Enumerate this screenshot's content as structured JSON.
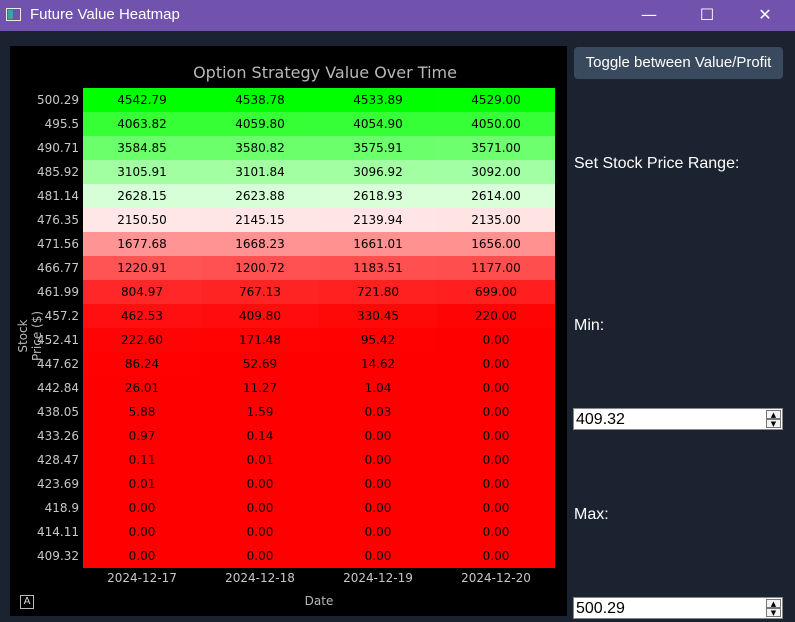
{
  "window": {
    "title": "Future Value Heatmap",
    "minimize_glyph": "—",
    "maximize_glyph": "☐",
    "close_glyph": "✕"
  },
  "plot": {
    "title": "Option Strategy Value Over Time",
    "xlabel": "Date",
    "ylabel": "Stock Price ($)",
    "auto_range_label": "A"
  },
  "controls": {
    "toggle_label": "Toggle between Value/Profit",
    "range_label": "Set Stock Price Range:",
    "min_label": "Min:",
    "min_value": "409.32",
    "max_label": "Max:",
    "max_value": "500.29"
  },
  "colors": {
    "titlebar": "#7152ad",
    "panel_bg": "#1b2330",
    "plot_bg": "#000000",
    "button_bg": "#3a4a5e",
    "high": "#00ff00",
    "low": "#ff0000"
  },
  "chart_data": {
    "type": "heatmap",
    "title": "Option Strategy Value Over Time",
    "xlabel": "Date",
    "ylabel": "Stock Price ($)",
    "x": [
      "2024-12-17",
      "2024-12-18",
      "2024-12-19",
      "2024-12-20"
    ],
    "y": [
      "500.29",
      "495.5",
      "490.71",
      "485.92",
      "481.14",
      "476.35",
      "471.56",
      "466.77",
      "461.99",
      "457.2",
      "452.41",
      "447.62",
      "442.84",
      "438.05",
      "433.26",
      "428.47",
      "423.69",
      "418.9",
      "414.11",
      "409.32"
    ],
    "values": [
      [
        "4542.79",
        "4538.78",
        "4533.89",
        "4529.00"
      ],
      [
        "4063.82",
        "4059.80",
        "4054.90",
        "4050.00"
      ],
      [
        "3584.85",
        "3580.82",
        "3575.91",
        "3571.00"
      ],
      [
        "3105.91",
        "3101.84",
        "3096.92",
        "3092.00"
      ],
      [
        "2628.15",
        "2623.88",
        "2618.93",
        "2614.00"
      ],
      [
        "2150.50",
        "2145.15",
        "2139.94",
        "2135.00"
      ],
      [
        "1677.68",
        "1668.23",
        "1661.01",
        "1656.00"
      ],
      [
        "1220.91",
        "1200.72",
        "1183.51",
        "1177.00"
      ],
      [
        "804.97",
        "767.13",
        "721.80",
        "699.00"
      ],
      [
        "462.53",
        "409.80",
        "330.45",
        "220.00"
      ],
      [
        "222.60",
        "171.48",
        "95.42",
        "0.00"
      ],
      [
        "86.24",
        "52.69",
        "14.62",
        "0.00"
      ],
      [
        "26.01",
        "11.27",
        "1.04",
        "0.00"
      ],
      [
        "5.88",
        "1.59",
        "0.03",
        "0.00"
      ],
      [
        "0.97",
        "0.14",
        "0.00",
        "0.00"
      ],
      [
        "0.11",
        "0.01",
        "0.00",
        "0.00"
      ],
      [
        "0.01",
        "0.00",
        "0.00",
        "0.00"
      ],
      [
        "0.00",
        "0.00",
        "0.00",
        "0.00"
      ],
      [
        "0.00",
        "0.00",
        "0.00",
        "0.00"
      ],
      [
        "0.00",
        "0.00",
        "0.00",
        "0.00"
      ]
    ],
    "colormap": [
      "#ff0000",
      "#ffffff",
      "#00ff00"
    ],
    "color_midpoint": 2270
  }
}
